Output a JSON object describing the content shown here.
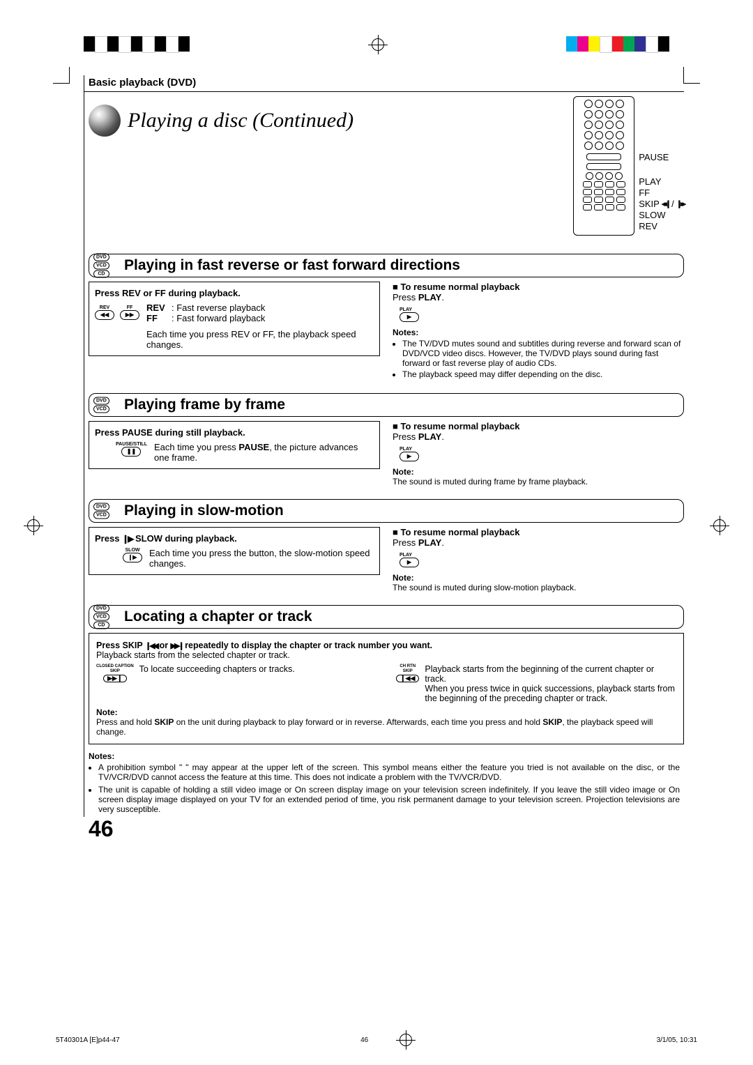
{
  "header_label": "Basic playback (DVD)",
  "title": "Playing a disc (Continued)",
  "remote_labels": [
    "PAUSE",
    "PLAY",
    "FF",
    "SKIP",
    "SLOW",
    "REV"
  ],
  "skip_glyph_a": "◂◂❙",
  "skip_glyph_b": "❙▸▸",
  "slash": " / ",
  "sec1": {
    "badges": [
      "DVD",
      "VCD",
      "CD"
    ],
    "heading": "Playing in fast reverse or fast forward directions",
    "left_press": "Press REV or FF during playback.",
    "rev_lbl": "REV",
    "rev_txt": "Fast reverse playback",
    "ff_lbl": "FF",
    "ff_txt": "Fast forward playback",
    "left_note": "Each time you press REV or FF, the playback speed changes.",
    "btn_rev_top": "REV",
    "btn_rev_sym": "◀◀",
    "btn_ff_top": "FF",
    "btn_ff_sym": "▶▶",
    "right_head": "To resume normal playback",
    "right_press_pre": "Press ",
    "right_press_b": "PLAY",
    "right_press_post": ".",
    "play_top": "PLAY",
    "play_sym": "▶",
    "notes_head": "Notes:",
    "note1": "The TV/DVD mutes sound and subtitles during reverse and forward scan of DVD/VCD video discs. However, the TV/DVD plays sound during fast forward or fast reverse play of audio CDs.",
    "note2": "The playback speed may differ depending on the disc."
  },
  "sec2": {
    "badges": [
      "DVD",
      "VCD"
    ],
    "heading": "Playing frame by frame",
    "left_press": "Press PAUSE during still playback.",
    "left_txt_pre": "Each time you press ",
    "left_txt_b": "PAUSE",
    "left_txt_post": ", the picture advances one frame.",
    "btn_top": "PAUSE/STILL",
    "btn_sym": "❚❚",
    "right_head": "To resume normal playback",
    "right_press_pre": "Press ",
    "right_press_b": "PLAY",
    "right_press_post": ".",
    "play_top": "PLAY",
    "play_sym": "▶",
    "note_head": "Note:",
    "note": "The sound is muted during frame by frame playback."
  },
  "sec3": {
    "badges": [
      "DVD",
      "VCD"
    ],
    "heading": "Playing in slow-motion",
    "left_press_pre": "Press ",
    "left_press_glyph": "❙▶",
    "left_press_post": " SLOW during playback.",
    "left_txt": "Each time you press the button, the slow-motion speed changes.",
    "btn_top": "SLOW",
    "btn_sym": "❙▶",
    "right_head": "To resume normal playback",
    "right_press_pre": "Press ",
    "right_press_b": "PLAY",
    "right_press_post": ".",
    "play_top": "PLAY",
    "play_sym": "▶",
    "note_head": "Note:",
    "note": "The sound is muted during slow-motion playback."
  },
  "sec4": {
    "badges": [
      "DVD",
      "VCD",
      "CD"
    ],
    "heading": "Locating a chapter or track",
    "line1_a": "Press SKIP ",
    "line1_g1": "❙◀◀",
    "line1_b": " or ",
    "line1_g2": "▶▶❙",
    "line1_c": " repeatedly to display the chapter or track number you want.",
    "line2": "Playback starts from the selected chapter or track.",
    "fwd_top1": "CLOSED CAPTION",
    "fwd_top2": "SKIP",
    "fwd_sym": "▶▶❙",
    "fwd_txt": "To locate succeeding chapters or tracks.",
    "rev_top1": "CH RTN",
    "rev_top2": "SKIP",
    "rev_sym": "❙◀◀",
    "rev_txt1": "Playback starts from the beginning of the current chapter or track.",
    "rev_txt2": "When you press twice in quick successions, playback starts from the beginning of the preceding chapter or track.",
    "inner_note_head": "Note:",
    "inner_note_a": "Press and hold ",
    "inner_note_b": "SKIP",
    "inner_note_c": " on the unit during playback to play forward or in reverse. Afterwards, each time you press and hold ",
    "inner_note_d": "SKIP",
    "inner_note_e": ", the playback speed will change."
  },
  "footer": {
    "head": "Notes:",
    "n1_a": "A prohibition symbol \" ",
    "n1_b": " \" may appear at the upper left of the screen. This symbol means either the feature you tried is not available on the disc, or the TV/VCR/DVD cannot access the feature at this time. This does not indicate a problem with the TV/VCR/DVD.",
    "n2": "The unit is capable of holding a still video image or On screen display image on your television screen indefinitely. If you leave the still video image or On screen display image displayed on your TV for an extended period of time, you risk permanent damage to your television screen. Projection televisions are very susceptible."
  },
  "page_num": "46",
  "print_file": "5T40301A [E]p44-47",
  "print_page": "46",
  "print_date": "3/1/05, 10:31"
}
